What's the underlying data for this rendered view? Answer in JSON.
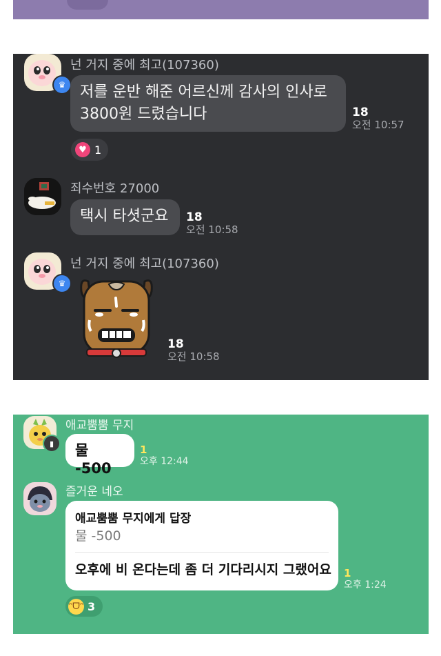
{
  "top_strip": {
    "color": "#8d7cae"
  },
  "dark_chat": {
    "messages": [
      {
        "sender": "넌 거지 중에 최고(107360)",
        "text_line1": "저를 운반 해준 어르신께 감사의 인사로",
        "text_line2": "3800원 드렸습니다",
        "count": "18",
        "time": "오전 10:57",
        "reaction_count": "1"
      },
      {
        "sender": "죄수번호 27000",
        "text": "택시 타셧군요",
        "count": "18",
        "time": "오전 10:58"
      },
      {
        "sender": "넌 거지 중에 최고(107360)",
        "sticker": "frodo-dog-sweating-sticker",
        "count": "18",
        "time": "오전 10:58"
      }
    ]
  },
  "green_chat": {
    "messages": [
      {
        "sender": "애교뿜뿜 무지",
        "text": "물 -500",
        "unread": "1",
        "time": "오후 12:44"
      },
      {
        "sender": "즐거운 네오",
        "reply_to": "애교뿜뿜 무지에게 답장",
        "reply_quote": "물 -500",
        "text": "오후에 비 온다는데 좀 더 기다리시지 그랬어요",
        "unread": "1",
        "time": "오후 1:24",
        "reaction_count": "3"
      }
    ]
  },
  "colors": {
    "dark_bg": "#2c2d30",
    "dark_bubble": "#4a4b4f",
    "green_bg": "#4fb584",
    "heart": "#f0457a",
    "unread": "#ffe75c"
  }
}
